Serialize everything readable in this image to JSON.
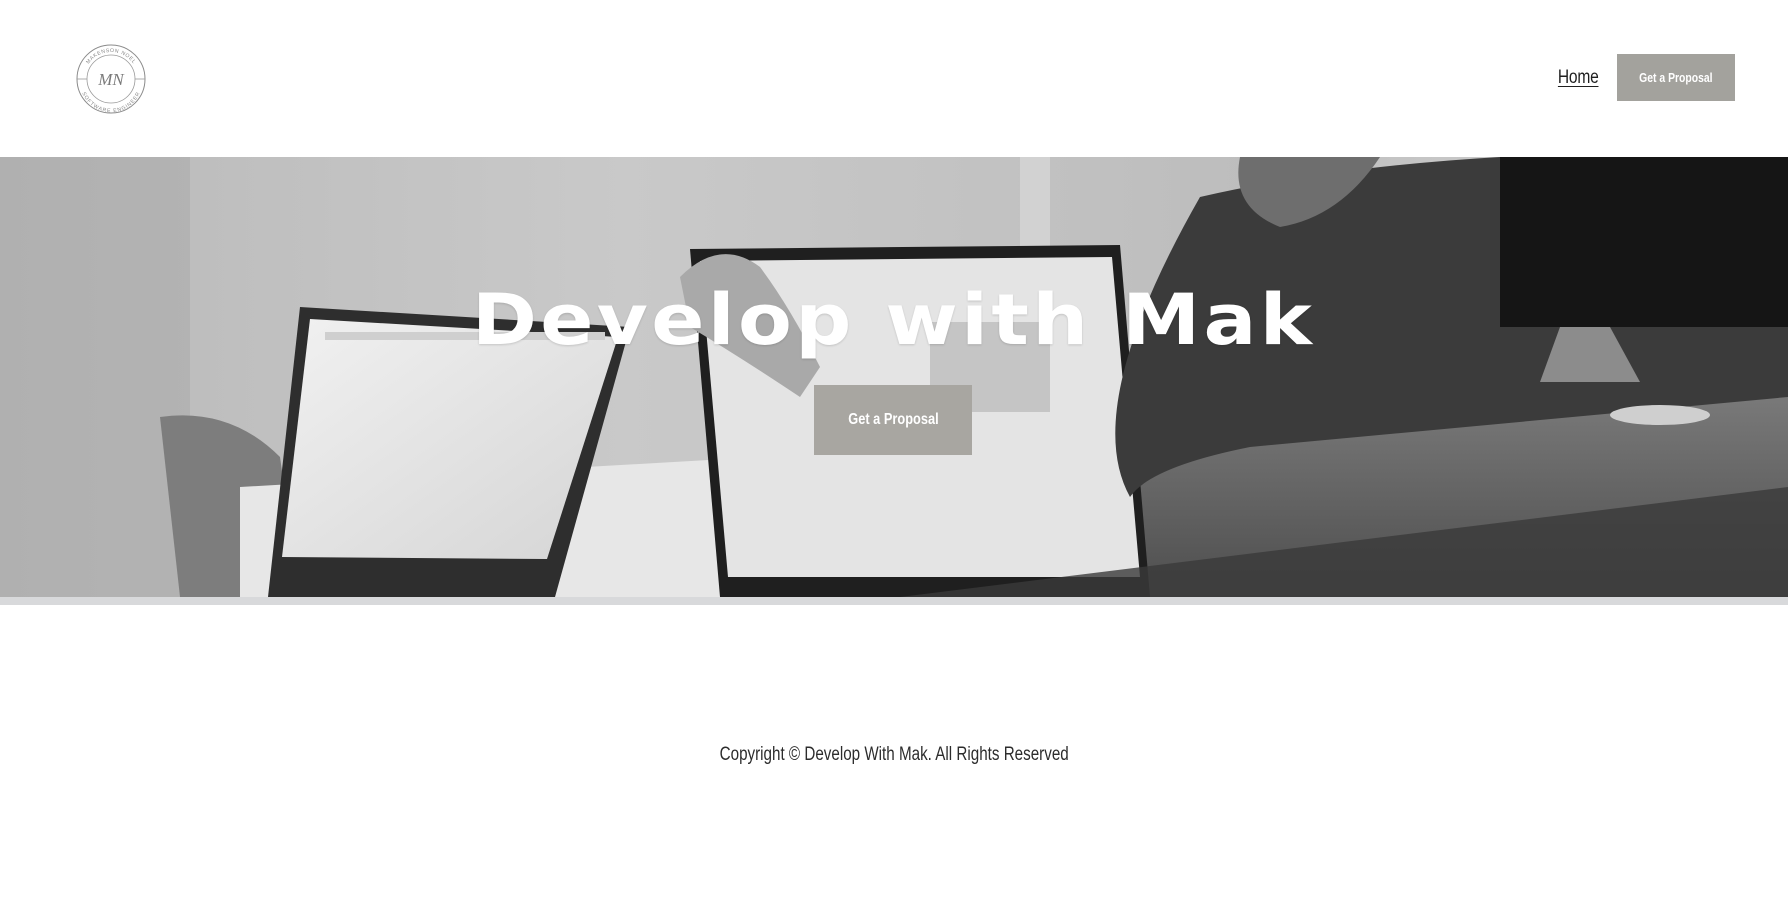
{
  "header": {
    "logo_text_top": "MAKENSON NOEL",
    "logo_text_bottom": "SOFTWARE ENGINEER",
    "logo_monogram": "MN",
    "nav_home": "Home",
    "nav_cta": "Get a Proposal"
  },
  "hero": {
    "title": "Develop with Mak",
    "cta": "Get a Proposal"
  },
  "footer": {
    "copyright": "Copyright © Develop With Mak. All Rights Reserved"
  },
  "colors": {
    "button_bg": "#a3a29d",
    "text_dark": "#2a2a2a",
    "background": "#ffffff"
  },
  "icons": {
    "logo": "circular-monogram-logo"
  }
}
